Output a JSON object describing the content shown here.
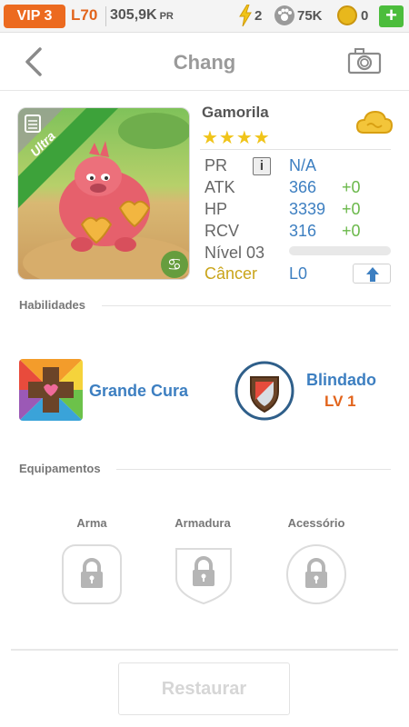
{
  "topbar": {
    "vip": "VIP 3",
    "level": "L70",
    "power_value": "305,9K",
    "power_unit": "PR",
    "energy": "2",
    "paw_points": "75K",
    "coins": "0",
    "add_label": "+"
  },
  "header": {
    "title": "Chang",
    "back_icon": "chevron-left-icon",
    "camera_icon": "camera-icon"
  },
  "monster": {
    "rarity": "Ultra",
    "name": "Gamorila",
    "stars": "★★★★",
    "star_count": 4,
    "stats": [
      {
        "label": "PR",
        "value": "N/A",
        "bonus": ""
      },
      {
        "label": "ATK",
        "value": "366",
        "bonus": "+0"
      },
      {
        "label": "HP",
        "value": "3339",
        "bonus": "+0"
      },
      {
        "label": "RCV",
        "value": "316",
        "bonus": "+0"
      }
    ],
    "level_label": "Nível 03",
    "level_progress": 0,
    "sign": "Câncer",
    "sign_level": "L0"
  },
  "abilities": {
    "title": "Habilidades",
    "items": [
      {
        "name": "Grande Cura",
        "icon": "heart-cross-icon"
      },
      {
        "name": "Blindado",
        "level": "LV 1",
        "icon": "shield-badge-icon"
      }
    ]
  },
  "equipment": {
    "title": "Equipamentos",
    "slots": [
      {
        "label": "Arma",
        "icon": "lock-icon"
      },
      {
        "label": "Armadura",
        "icon": "lock-icon"
      },
      {
        "label": "Acessório",
        "icon": "lock-icon"
      }
    ]
  },
  "actions": {
    "restore": "Restaurar"
  },
  "colors": {
    "accent_orange": "#ec6a1f",
    "value_blue": "#3d7fc1",
    "bonus_green": "#6ab84a",
    "sign_gold": "#c9a419"
  }
}
